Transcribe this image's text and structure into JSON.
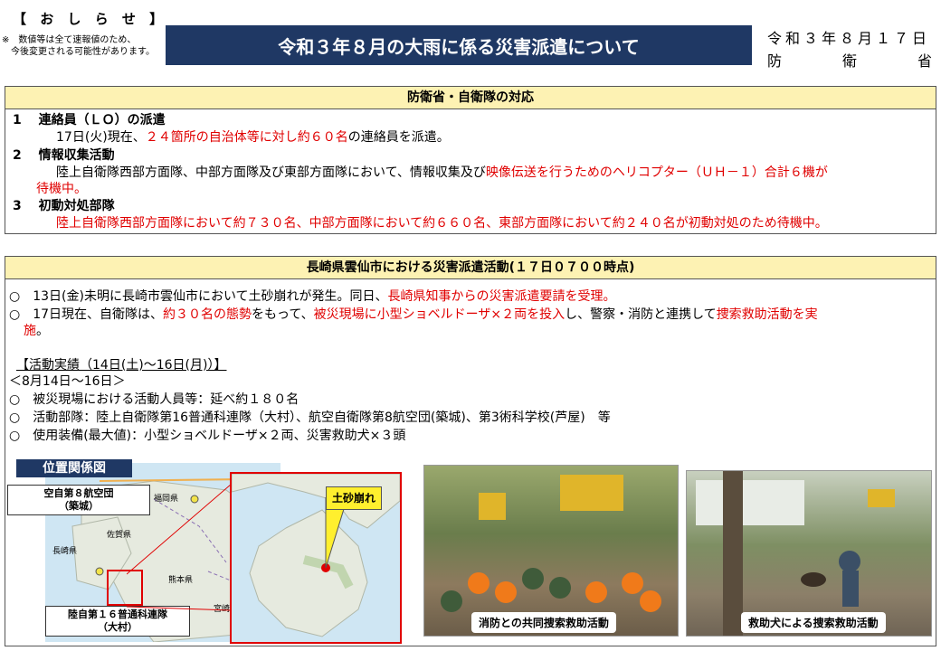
{
  "header": {
    "notice": "【 お し ら せ 】",
    "caveat_line1": "※　数値等は全て速報値のため、",
    "caveat_line2": "　今後変更される可能性があります。",
    "title": "令和３年８月の大雨に係る災害派遣について",
    "date": "令和３年８月１７日",
    "org_chars": [
      "防",
      "衛",
      "省"
    ]
  },
  "section1": {
    "heading": "防衛省・自衛隊の対応",
    "item1_title": "1　 連絡員（ＬＯ）の派遣",
    "item1_body_a": "17日(火)現在、",
    "item1_body_red": "２４箇所の自治体等に対し約６０名",
    "item1_body_b": "の連絡員を派遣。",
    "item2_title": "2　 情報収集活動",
    "item2_body_a": "陸上自衛隊西部方面隊、中部方面隊及び東部方面隊において、情報収集及び",
    "item2_body_red": "映像伝送を行うためのヘリコプター（ＵＨ－１）合計６機が",
    "item2_body_red2": "待機中。",
    "item3_title": "3　 初動対処部隊",
    "item3_body_red": "陸上自衛隊西部方面隊において約７３０名、中部方面隊において約６６０名、東部方面隊において約２４０名が初動対処のため待機中。"
  },
  "section2": {
    "heading": "長崎県雲仙市における災害派遣活動(１７日０７００時点)",
    "p1_a": "○　13日(金)未明に長崎市雲仙市において土砂崩れが発生。同日、",
    "p1_red": "長崎県知事からの災害派遣要請を受理。",
    "p2_a": "○　17日現在、自衛隊は、",
    "p2_red1": "約３０名の態勢",
    "p2_b": "をもって、",
    "p2_red2": "被災現場に小型ショベルドーザ×２両を投入",
    "p2_c": "し、警察・消防と連携して",
    "p2_red3": "捜索救助活動を実",
    "p2_red4": "施",
    "p2_d": "。",
    "record_title": "【活動実績（14日(土)～16日(月)）】",
    "record_period": "＜8月14日～16日＞",
    "record_items": [
      "○　被災現場における活動人員等：延べ約１８０名",
      "○　活動部隊：陸上自衛隊第16普通科連隊（大村）、航空自衛隊第8航空団(築城)、第3術科学校(芦屋)　等",
      "○　使用装備(最大値)：小型ショベルドーザ×２両、災害救助犬×３頭"
    ]
  },
  "map": {
    "title": "位置関係図",
    "label_air": "空自第８航空団\n（築城）",
    "label_army": "陸自第１６普通科連隊\n（大村）",
    "label_slide": "土砂崩れ",
    "places": [
      "福岡県",
      "佐賀県",
      "長崎県",
      "熊本県",
      "宮崎"
    ]
  },
  "photos": {
    "caption1": "消防との共同捜索救助活動",
    "caption2": "救助犬による捜索救助活動"
  },
  "colors": {
    "title_bg": "#1f3864",
    "head_bg": "#fdf2b3",
    "accent_red": "#e00000"
  }
}
